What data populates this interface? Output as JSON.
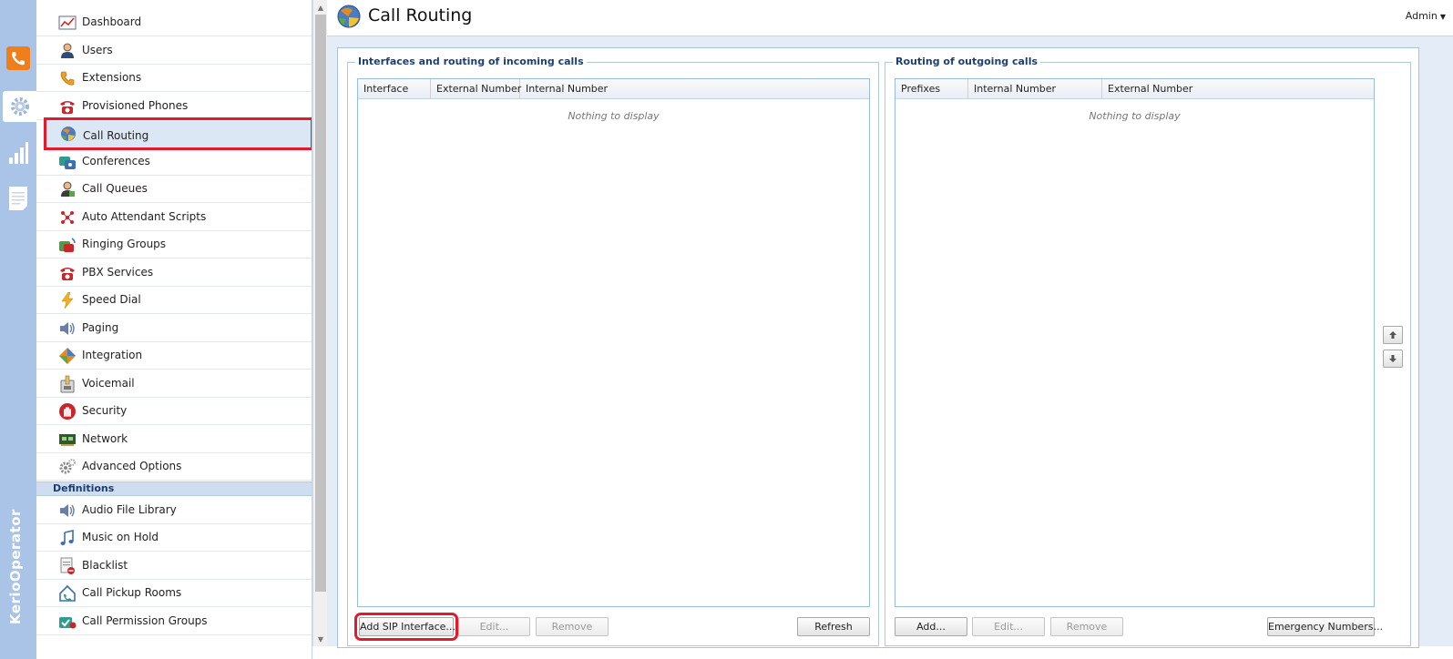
{
  "rail": {
    "brand": "KerioOperator",
    "accent": "#f07e1b"
  },
  "sidebar": {
    "items": [
      {
        "label": "Dashboard"
      },
      {
        "label": "Users"
      },
      {
        "label": "Extensions"
      },
      {
        "label": "Provisioned Phones"
      },
      {
        "label": "Call Routing"
      },
      {
        "label": "Conferences"
      },
      {
        "label": "Call Queues"
      },
      {
        "label": "Auto Attendant Scripts"
      },
      {
        "label": "Ringing Groups"
      },
      {
        "label": "PBX Services"
      },
      {
        "label": "Speed Dial"
      },
      {
        "label": "Paging"
      },
      {
        "label": "Integration"
      },
      {
        "label": "Voicemail"
      },
      {
        "label": "Security"
      },
      {
        "label": "Network"
      },
      {
        "label": "Advanced Options"
      }
    ],
    "section_label": "Definitions",
    "def_items": [
      {
        "label": "Audio File Library"
      },
      {
        "label": "Music on Hold"
      },
      {
        "label": "Blacklist"
      },
      {
        "label": "Call Pickup Rooms"
      },
      {
        "label": "Call Permission Groups"
      }
    ],
    "selected": "Call Routing"
  },
  "header": {
    "title": "Call Routing",
    "user": "Admin"
  },
  "incoming": {
    "legend": "Interfaces and routing of incoming calls",
    "columns": [
      "Interface",
      "External Number",
      "Internal Number"
    ],
    "empty_text": "Nothing to display",
    "buttons": {
      "add": "Add SIP Interface...",
      "edit": "Edit...",
      "remove": "Remove",
      "refresh": "Refresh"
    }
  },
  "outgoing": {
    "legend": "Routing of outgoing calls",
    "columns": [
      "Prefixes",
      "Internal Number",
      "External Number"
    ],
    "empty_text": "Nothing to display",
    "buttons": {
      "add": "Add...",
      "edit": "Edit...",
      "remove": "Remove",
      "emergency": "Emergency Numbers..."
    }
  },
  "colors": {
    "highlight": "#e21b2c",
    "legend": "#1c3f74",
    "rail": "#a9c4e6"
  }
}
